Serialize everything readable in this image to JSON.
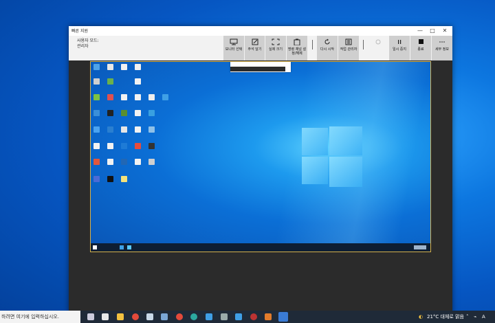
{
  "window": {
    "title": "빠른 지원",
    "user_mode_label": "사용자 모드:",
    "user_mode_value": "관리자",
    "minimize_glyph": "—",
    "maximize_glyph": "□",
    "close_glyph": "✕"
  },
  "toolbar": {
    "select_monitor": "모니터 선택",
    "annotate": "주석 달기",
    "actual_size": "실제 크기",
    "toggle_channel": "명령 채널 설정/해제",
    "restart": "다시 시작",
    "task_manager": "작업 관리자",
    "pause": "일시 중지",
    "end": "종료",
    "details": "세부 정보"
  },
  "taskbar": {
    "search_placeholder": "하려면 여기에 입력하십시오.",
    "weather": "21°C  대체로 맑음",
    "lang": "A"
  },
  "colors": {
    "accent": "#0078d4",
    "remote_border": "#d8b24a",
    "window_bg": "#2b2b2b"
  }
}
